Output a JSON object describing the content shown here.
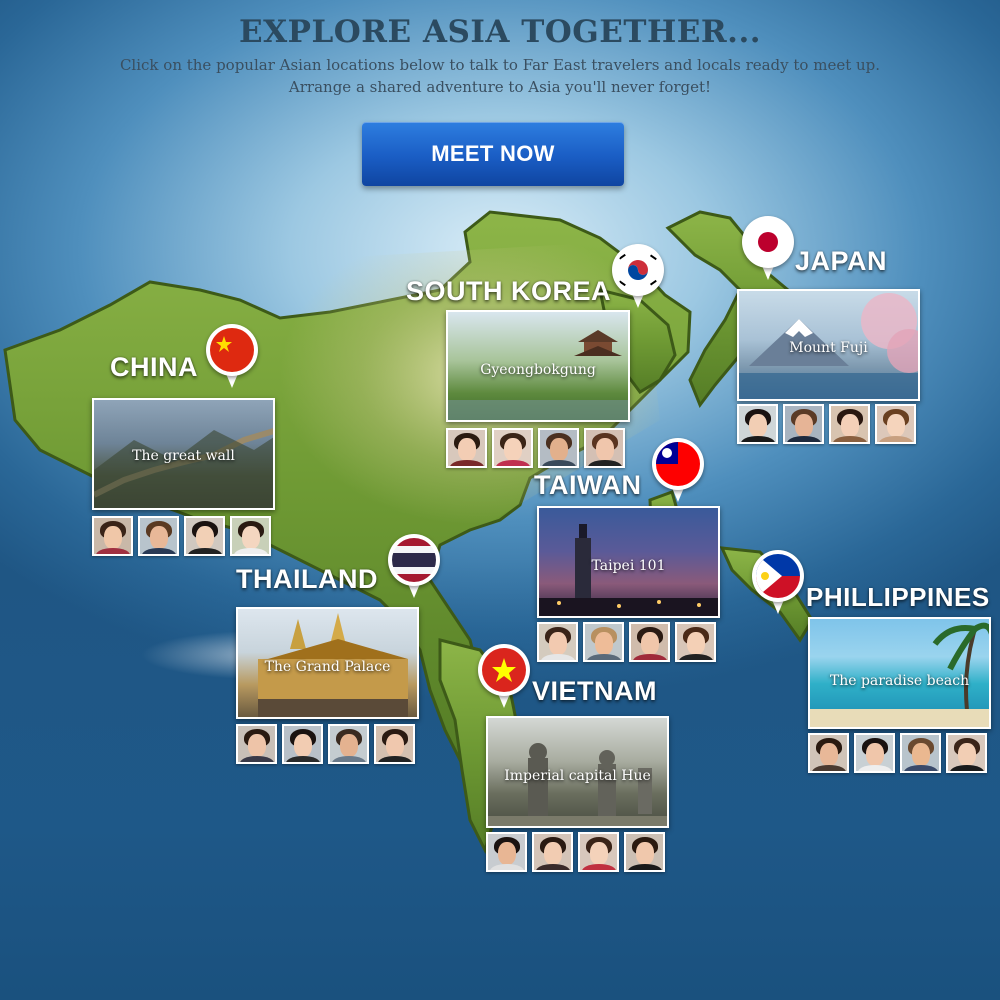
{
  "header": {
    "title": "EXPLORE ASIA TOGETHER...",
    "subtitle_line1": "Click on the popular Asian locations below to talk to Far East travelers and locals ready to meet up.",
    "subtitle_line2": "Arrange a shared adventure to Asia you'll never forget!"
  },
  "cta": {
    "label": "MEET NOW",
    "color": "#1a5dc4"
  },
  "colors": {
    "land": "#6f9a34",
    "land_dark": "#4a6d1f",
    "text_heading": "#2b4a60"
  },
  "locations": [
    {
      "id": "china",
      "country": "CHINA",
      "landmark": "The great wall",
      "flag_icon": "china-flag-icon"
    },
    {
      "id": "south-korea",
      "country": "SOUTH KOREA",
      "landmark": "Gyeongbokgung",
      "flag_icon": "south-korea-flag-icon"
    },
    {
      "id": "japan",
      "country": "JAPAN",
      "landmark": "Mount Fuji",
      "flag_icon": "japan-flag-icon"
    },
    {
      "id": "taiwan",
      "country": "TAIWAN",
      "landmark": "Taipei 101",
      "flag_icon": "taiwan-flag-icon"
    },
    {
      "id": "thailand",
      "country": "THAILAND",
      "landmark": "The Grand Palace",
      "flag_icon": "thailand-flag-icon"
    },
    {
      "id": "philippines",
      "country": "PHILLIPPINES",
      "landmark": "The paradise beach",
      "flag_icon": "philippines-flag-icon"
    },
    {
      "id": "vietnam",
      "country": "VIETNAM",
      "landmark": "Imperial capital Hue",
      "flag_icon": "vietnam-flag-icon"
    }
  ]
}
